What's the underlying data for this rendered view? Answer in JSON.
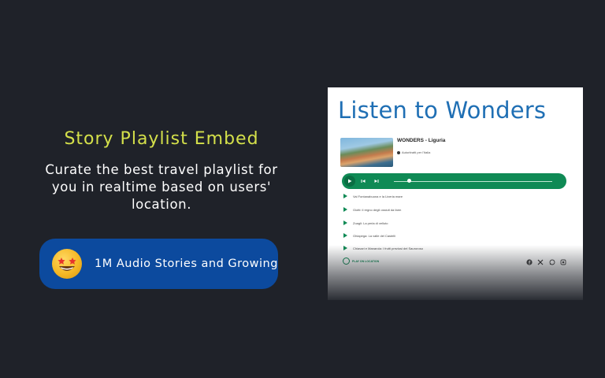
{
  "hero": {
    "heading": "Story Playlist Embed",
    "description": "Curate the best travel playlist for you in realtime based on users' location.",
    "cta": {
      "emoji_icon": "star-struck-emoji-icon",
      "label": "1M Audio Stories and Growing"
    }
  },
  "preview": {
    "title": "Listen to Wonders",
    "track": {
      "title": "WONDERS - Liguria",
      "subtitle": "Autoritratti per l'Italia"
    },
    "player": {
      "controls": [
        "play-icon",
        "skip-back-icon",
        "skip-forward-icon"
      ]
    },
    "playlist": [
      "Val Fontanabuona e la Liveria mare",
      "Giotti: il regno degli ossiuti da farm",
      "Zoagli: La perla di velluto",
      "Ghiapega: La valle del Castelli",
      "Chiavari e Manarola: I frutti preziosi del Sauroroso"
    ],
    "footer": {
      "logo_text": "PLAY ON LOCATION",
      "social_icons": [
        "facebook-icon",
        "x-icon",
        "whatsapp-icon",
        "share-icon"
      ]
    }
  },
  "colors": {
    "background": "#1f2229",
    "heading": "#d4e04a",
    "pill": "#0c4a9e",
    "preview_title": "#1f6fb4",
    "player": "#0f8a55"
  }
}
